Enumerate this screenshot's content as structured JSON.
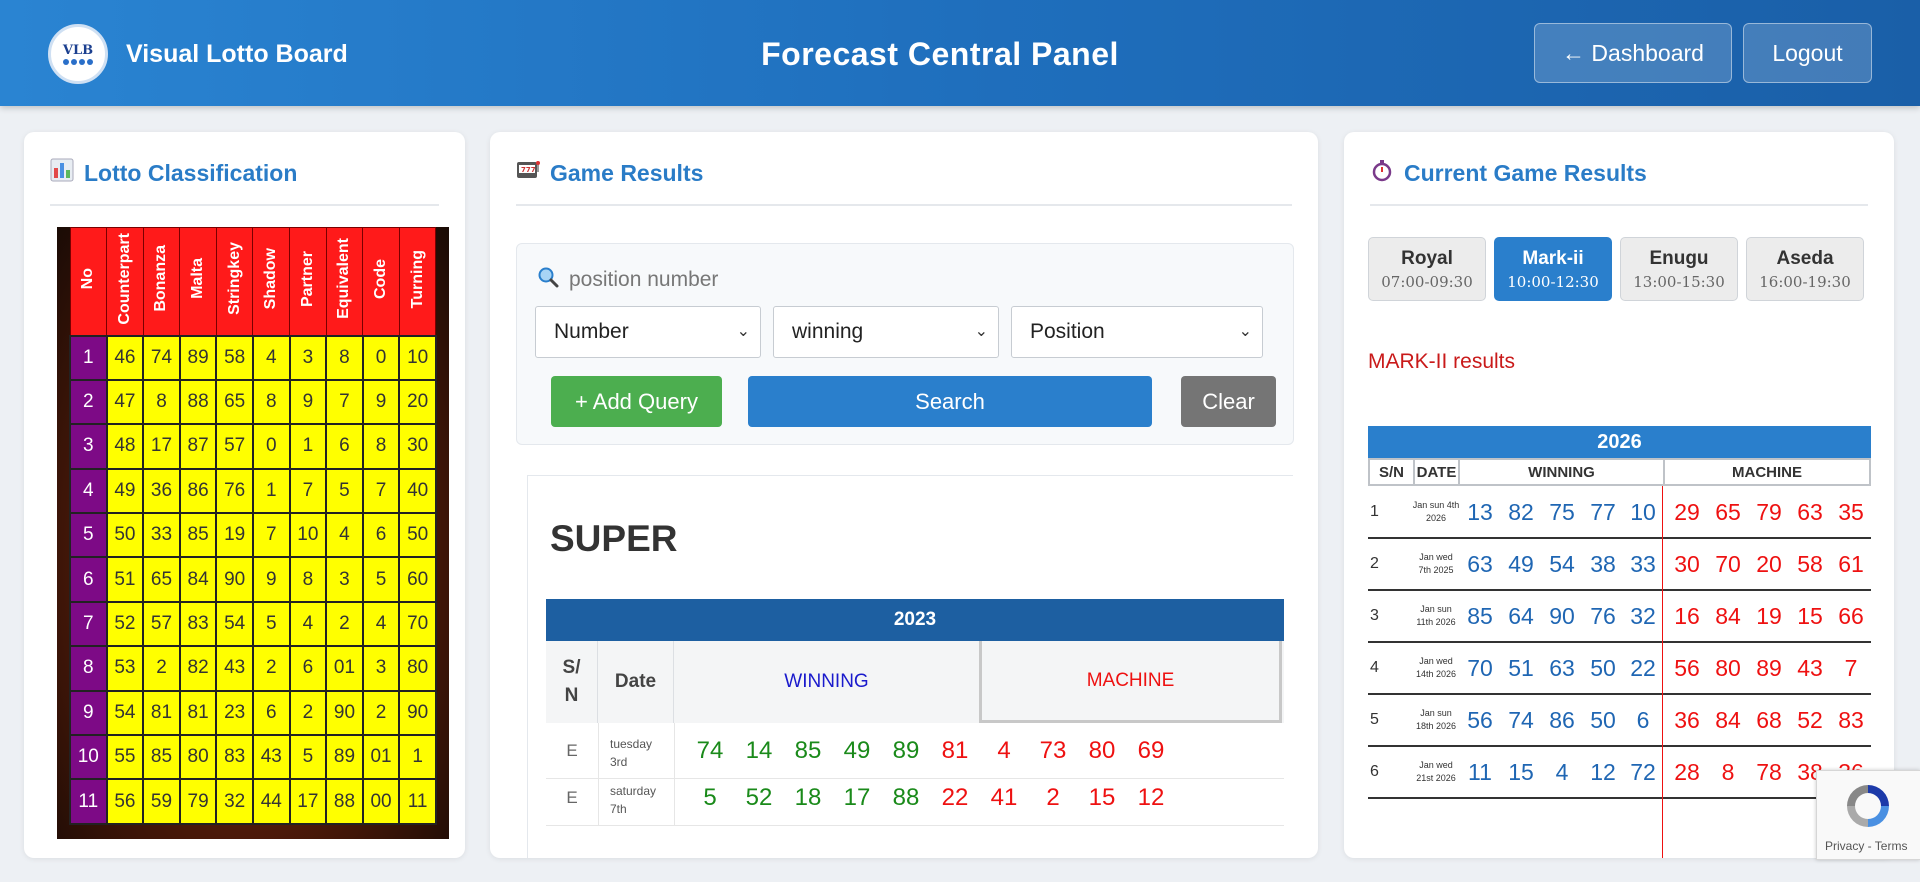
{
  "header": {
    "logo_text": "VLB",
    "brand": "Visual Lotto Board",
    "title": "Forecast Central Panel",
    "dashboard_button": "← Dashboard",
    "logout_button": "Logout"
  },
  "left": {
    "title": "Lotto Classification",
    "columns": [
      "No",
      "Counterpart",
      "Bonanza",
      "Malta",
      "Stringkey",
      "Shadow",
      "Partner",
      "Equivalent",
      "Code",
      "Turning"
    ],
    "rows": [
      [
        "1",
        "46",
        "74",
        "89",
        "58",
        "4",
        "3",
        "8",
        "0",
        "10"
      ],
      [
        "2",
        "47",
        "8",
        "88",
        "65",
        "8",
        "9",
        "7",
        "9",
        "20"
      ],
      [
        "3",
        "48",
        "17",
        "87",
        "57",
        "0",
        "1",
        "6",
        "8",
        "30"
      ],
      [
        "4",
        "49",
        "36",
        "86",
        "76",
        "1",
        "7",
        "5",
        "7",
        "40"
      ],
      [
        "5",
        "50",
        "33",
        "85",
        "19",
        "7",
        "10",
        "4",
        "6",
        "50"
      ],
      [
        "6",
        "51",
        "65",
        "84",
        "90",
        "9",
        "8",
        "3",
        "5",
        "60"
      ],
      [
        "7",
        "52",
        "57",
        "83",
        "54",
        "5",
        "4",
        "2",
        "4",
        "70"
      ],
      [
        "8",
        "53",
        "2",
        "82",
        "43",
        "2",
        "6",
        "01",
        "3",
        "80"
      ],
      [
        "9",
        "54",
        "81",
        "81",
        "23",
        "6",
        "2",
        "90",
        "2",
        "90"
      ],
      [
        "10",
        "55",
        "85",
        "80",
        "83",
        "43",
        "5",
        "89",
        "01",
        "1"
      ],
      [
        "11",
        "56",
        "59",
        "79",
        "32",
        "44",
        "17",
        "88",
        "00",
        "11"
      ]
    ]
  },
  "middle": {
    "title": "Game Results",
    "search_placeholder": "position number",
    "select_number": "Number",
    "select_winning": "winning",
    "select_position": "Position",
    "add_query": "+ Add Query",
    "search": "Search",
    "clear": "Clear",
    "game_name": "SUPER",
    "year": "2023",
    "col_sn": "S/\nN",
    "col_date": "Date",
    "col_winning": "WINNING",
    "col_machine": "MACHINE",
    "rows": [
      {
        "sn": "E",
        "date": "tuesday 3rd",
        "winning": [
          "74",
          "14",
          "85",
          "49",
          "89"
        ],
        "machine": [
          "81",
          "4",
          "73",
          "80",
          "69"
        ]
      },
      {
        "sn": "E",
        "date": "saturday 7th",
        "winning": [
          "5",
          "52",
          "18",
          "17",
          "88"
        ],
        "machine": [
          "22",
          "41",
          "2",
          "15",
          "12"
        ]
      }
    ]
  },
  "right": {
    "title": "Current Game Results",
    "games": [
      {
        "name": "Royal",
        "time": "07:00-09:30",
        "active": false
      },
      {
        "name": "Mark-ii",
        "time": "10:00-12:30",
        "active": true
      },
      {
        "name": "Enugu",
        "time": "13:00-15:30",
        "active": false
      },
      {
        "name": "Aseda",
        "time": "16:00-19:30",
        "active": false
      }
    ],
    "results_label": "MARK-II results",
    "year": "2026",
    "col_sn": "S/N",
    "col_date": "DATE",
    "col_winning": "WINNING",
    "col_machine": "MACHINE",
    "rows": [
      {
        "sn": "1",
        "date": "Jan sun 4th 2026",
        "winning": [
          "13",
          "82",
          "75",
          "77",
          "10"
        ],
        "machine": [
          "29",
          "65",
          "79",
          "63",
          "35"
        ]
      },
      {
        "sn": "2",
        "date": "Jan wed 7th 2025",
        "winning": [
          "63",
          "49",
          "54",
          "38",
          "33"
        ],
        "machine": [
          "30",
          "70",
          "20",
          "58",
          "61"
        ]
      },
      {
        "sn": "3",
        "date": "Jan sun 11th 2026",
        "winning": [
          "85",
          "64",
          "90",
          "76",
          "32"
        ],
        "machine": [
          "16",
          "84",
          "19",
          "15",
          "66"
        ]
      },
      {
        "sn": "4",
        "date": "Jan wed 14th 2026",
        "winning": [
          "70",
          "51",
          "63",
          "50",
          "22"
        ],
        "machine": [
          "56",
          "80",
          "89",
          "43",
          "7"
        ]
      },
      {
        "sn": "5",
        "date": "Jan sun 18th 2026",
        "winning": [
          "56",
          "74",
          "86",
          "50",
          "6"
        ],
        "machine": [
          "36",
          "84",
          "68",
          "52",
          "83"
        ]
      },
      {
        "sn": "6",
        "date": "Jan wed 21st 2026",
        "winning": [
          "11",
          "15",
          "4",
          "12",
          "72"
        ],
        "machine": [
          "28",
          "8",
          "78",
          "38",
          "36"
        ]
      }
    ]
  },
  "recaptcha": {
    "text": "Privacy - Terms"
  }
}
